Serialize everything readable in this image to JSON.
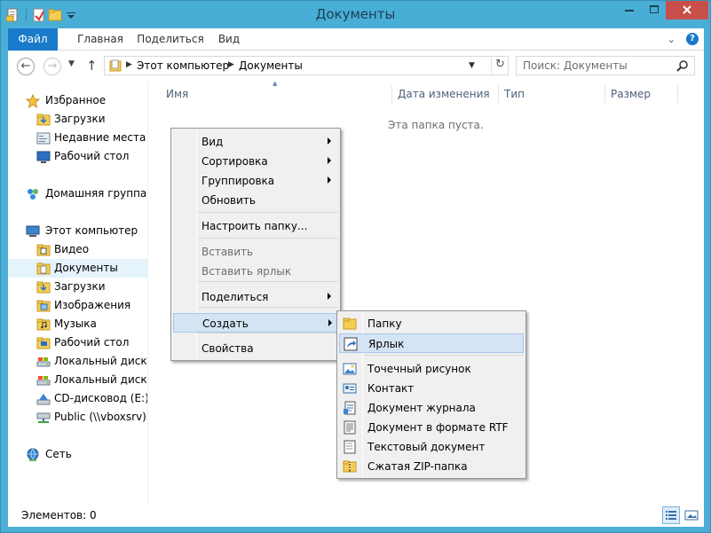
{
  "window": {
    "title": "Документы"
  },
  "colors": {
    "titlebar": "#49aed6",
    "file_tab": "#1979ca",
    "close_button": "#c7504a",
    "selection": "#e5f3fb",
    "menu_highlight": "#d5e4f4"
  },
  "ribbon": {
    "tabs": [
      "Файл",
      "Главная",
      "Поделиться",
      "Вид"
    ]
  },
  "address": {
    "crumbs": [
      "Этот компьютер",
      "Документы"
    ]
  },
  "search": {
    "placeholder": "Поиск: Документы"
  },
  "nav": {
    "items": [
      {
        "label": "Избранное",
        "icon": "star-icon",
        "kind": "group"
      },
      {
        "label": "Загрузки",
        "icon": "downloads-folder-icon",
        "kind": "child"
      },
      {
        "label": "Недавние места",
        "icon": "recent-places-icon",
        "kind": "child"
      },
      {
        "label": "Рабочий стол",
        "icon": "desktop-icon",
        "kind": "child"
      },
      {
        "label": "Домашняя группа",
        "icon": "homegroup-icon",
        "kind": "group"
      },
      {
        "label": "Этот компьютер",
        "icon": "computer-icon",
        "kind": "group"
      },
      {
        "label": "Видео",
        "icon": "video-folder-icon",
        "kind": "child"
      },
      {
        "label": "Документы",
        "icon": "documents-folder-icon",
        "kind": "child",
        "selected": true
      },
      {
        "label": "Загрузки",
        "icon": "downloads-folder-icon",
        "kind": "child"
      },
      {
        "label": "Изображения",
        "icon": "pictures-folder-icon",
        "kind": "child"
      },
      {
        "label": "Музыка",
        "icon": "music-folder-icon",
        "kind": "child"
      },
      {
        "label": "Рабочий стол",
        "icon": "desktop-folder-icon",
        "kind": "child"
      },
      {
        "label": "Локальный диск (C",
        "icon": "drive-icon",
        "kind": "child"
      },
      {
        "label": "Локальный диск (D",
        "icon": "drive-icon",
        "kind": "child"
      },
      {
        "label": "CD-дисковод (E:) Vi",
        "icon": "cd-drive-icon",
        "kind": "child"
      },
      {
        "label": "Public (\\\\vboxsrv) (F",
        "icon": "network-drive-icon",
        "kind": "child"
      },
      {
        "label": "Сеть",
        "icon": "network-icon",
        "kind": "group"
      }
    ]
  },
  "columns": [
    "Имя",
    "Дата изменения",
    "Тип",
    "Размер"
  ],
  "empty_message": "Эта папка пуста.",
  "status": {
    "items_count": "Элементов: 0"
  },
  "context_menu": {
    "items": [
      {
        "label": "Вид",
        "submenu": true
      },
      {
        "label": "Сортировка",
        "submenu": true
      },
      {
        "label": "Группировка",
        "submenu": true
      },
      {
        "label": "Обновить"
      },
      {
        "label": "Настроить папку..."
      },
      {
        "label": "Вставить",
        "disabled": true
      },
      {
        "label": "Вставить ярлык",
        "disabled": true
      },
      {
        "label": "Поделиться",
        "submenu": true
      },
      {
        "label": "Создать",
        "submenu": true,
        "highlighted": true
      },
      {
        "label": "Свойства"
      }
    ]
  },
  "create_submenu": {
    "items": [
      {
        "label": "Папку",
        "icon": "folder-icon"
      },
      {
        "label": "Ярлык",
        "icon": "shortcut-icon",
        "highlighted": true
      },
      {
        "label": "Точечный рисунок",
        "icon": "bitmap-icon"
      },
      {
        "label": "Контакт",
        "icon": "contact-icon"
      },
      {
        "label": "Документ журнала",
        "icon": "journal-document-icon"
      },
      {
        "label": "Документ в формате RTF",
        "icon": "rtf-document-icon"
      },
      {
        "label": "Текстовый документ",
        "icon": "text-document-icon"
      },
      {
        "label": "Сжатая ZIP-папка",
        "icon": "zip-folder-icon"
      }
    ]
  }
}
